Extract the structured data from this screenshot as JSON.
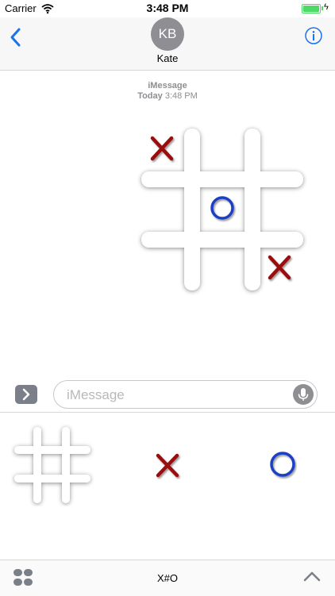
{
  "status_bar": {
    "carrier": "Carrier",
    "time": "3:48 PM",
    "battery_color": "#4cd964"
  },
  "header": {
    "avatar_initials": "KB",
    "contact_name": "Kate",
    "back_icon": "chevron-left-icon",
    "info_icon": "info-icon",
    "accent_color": "#1a73e8"
  },
  "transcript": {
    "service_label": "iMessage",
    "timestamp_day": "Today",
    "timestamp_time": "3:48 PM",
    "board": {
      "cells": [
        "X",
        "",
        "",
        "",
        "O",
        "",
        "",
        "",
        "X"
      ]
    }
  },
  "input": {
    "placeholder": "iMessage",
    "expand_icon": "chevron-right-icon",
    "mic_icon": "microphone-icon"
  },
  "drawer": {
    "stickers": [
      "board-sticker",
      "x-sticker",
      "o-sticker"
    ],
    "x_color": "#9b1111",
    "o_color": "#1c3fc4"
  },
  "bottom_bar": {
    "app_title": "X#O",
    "apps_icon": "app-grid-icon",
    "collapse_icon": "chevron-up-icon"
  }
}
